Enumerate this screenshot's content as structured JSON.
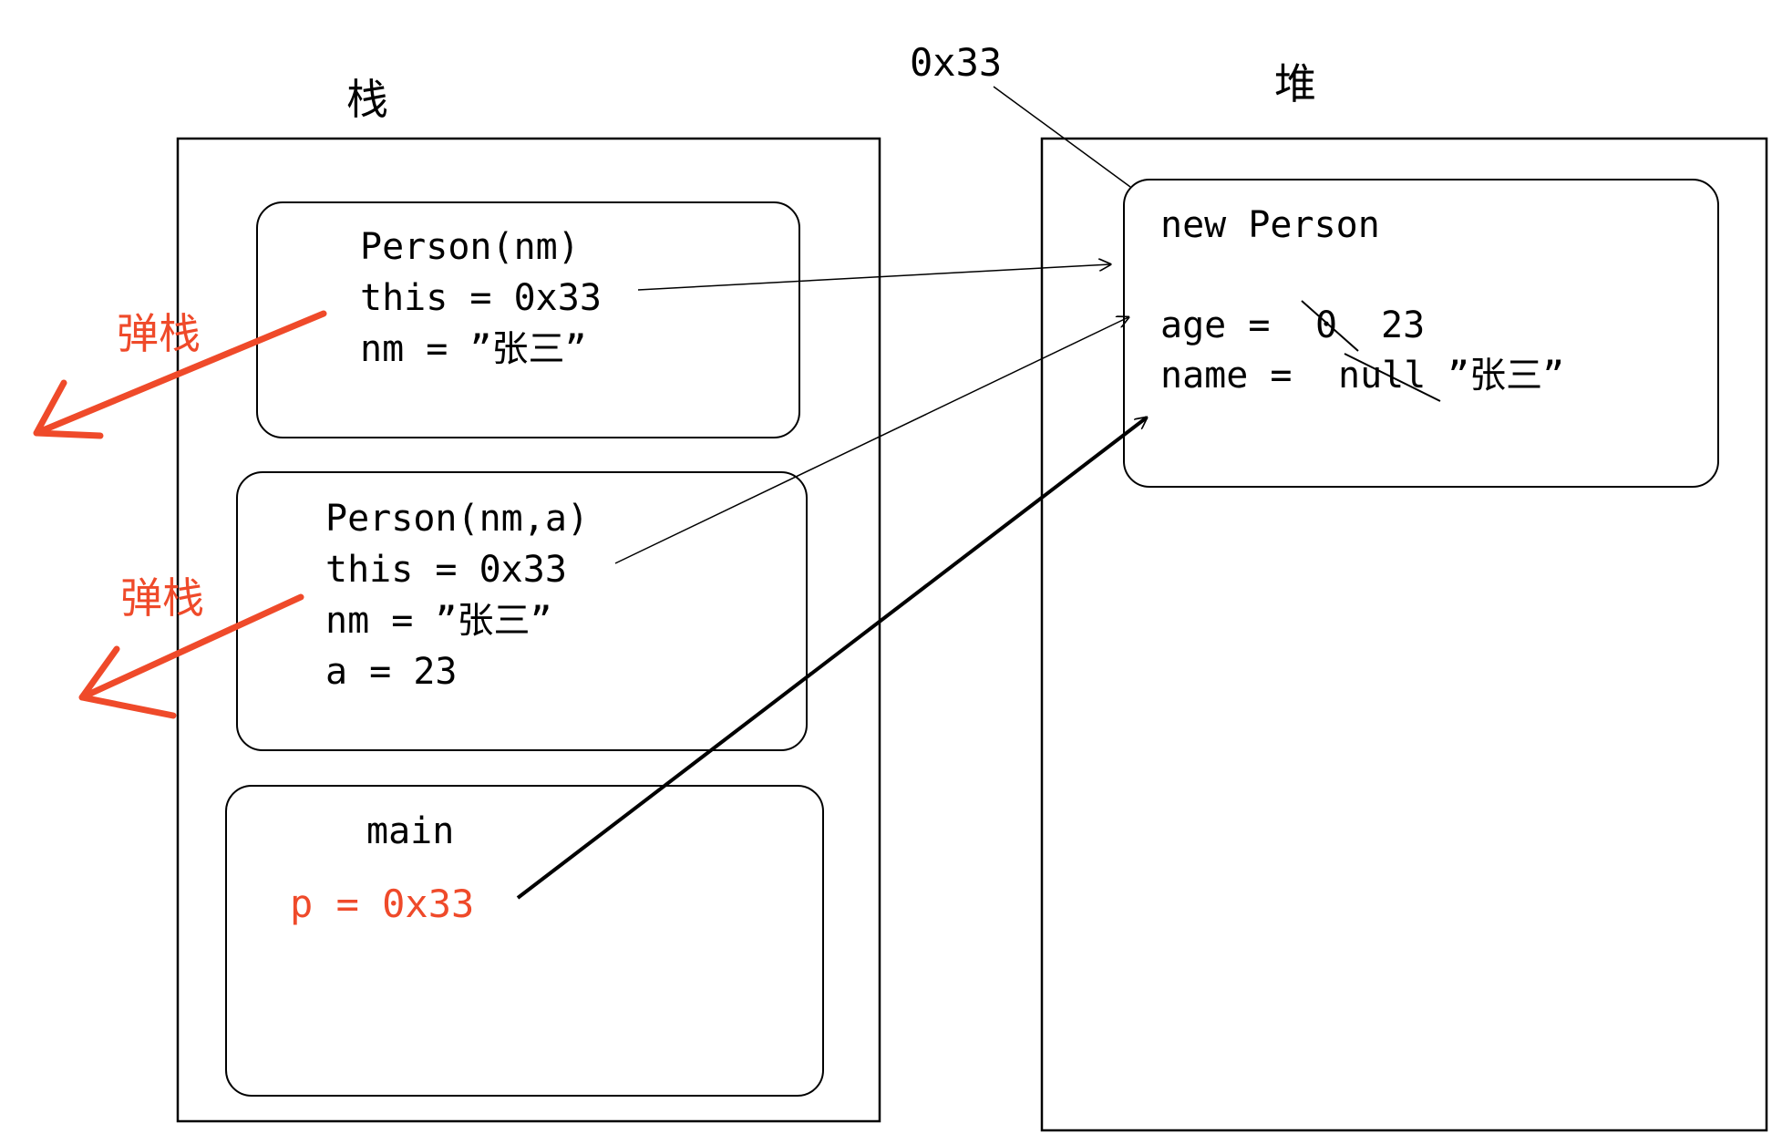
{
  "stack": {
    "title": "栈",
    "frames": [
      {
        "lines": [
          "Person(nm)",
          "this = 0x33",
          "nm = ”张三”"
        ]
      },
      {
        "lines": [
          "Person(nm,a)",
          "this = 0x33",
          "nm = ”张三”",
          "a = 23"
        ]
      },
      {
        "title": "main",
        "var": "p = 0x33"
      }
    ],
    "pop_label": "弹栈"
  },
  "heap": {
    "title": "堆",
    "address": "0x33",
    "object": {
      "title": "new Person",
      "age_label": "age = ",
      "age_old": "0",
      "age_new": "23",
      "name_label": "name = ",
      "name_old": "null",
      "name_new": "”张三”"
    }
  },
  "colors": {
    "ink": "#000000",
    "accent": "#ef4a2a",
    "background": "#ffffff"
  }
}
